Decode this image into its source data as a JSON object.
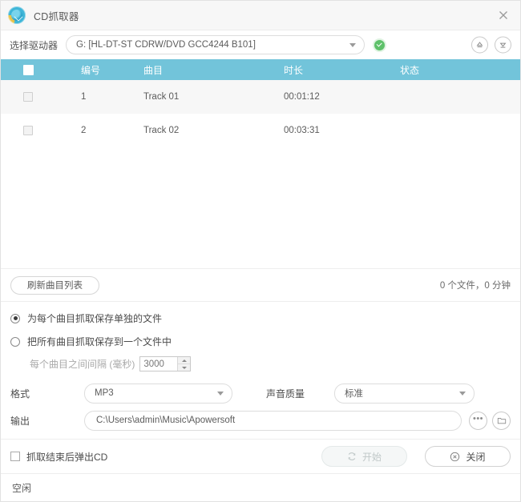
{
  "window": {
    "title": "CD抓取器",
    "logo_icon": "cd-ripper-logo-icon",
    "close_icon": "close-icon"
  },
  "drive": {
    "label": "选择驱动器",
    "selected": "G: [HL-DT-ST CDRW/DVD GCC4244 B101]",
    "status_icon": "green-check-icon",
    "eject_icon": "eject-icon",
    "close_tray_icon": "close-tray-icon"
  },
  "table": {
    "columns": [
      "",
      "编号",
      "曲目",
      "时长",
      "状态"
    ],
    "header_checkbox_icon": "select-all-checkbox",
    "rows": [
      {
        "checked": false,
        "no": "1",
        "title": "Track 01",
        "duration": "00:01:12",
        "status": ""
      },
      {
        "checked": false,
        "no": "2",
        "title": "Track 02",
        "duration": "00:03:31",
        "status": ""
      }
    ]
  },
  "toolbar": {
    "refresh_label": "刷新曲目列表",
    "counts": "0 个文件，0 分钟"
  },
  "save_mode": {
    "separate_label": "为每个曲目抓取保存单独的文件",
    "merged_label": "把所有曲目抓取保存到一个文件中",
    "selected": "separate",
    "gap_label": "每个曲目之间间隔 (毫秒)",
    "gap_value": "3000"
  },
  "settings": {
    "format_label": "格式",
    "format_value": "MP3",
    "quality_label": "声音质量",
    "quality_value": "标准",
    "output_label": "输出",
    "output_path": "C:\\Users\\admin\\Music\\Apowersoft",
    "browse_icon": "ellipsis-icon",
    "open_folder_icon": "folder-open-icon"
  },
  "actions": {
    "eject_after_label": "抓取结束后弹出CD",
    "eject_after_checked": false,
    "start_label": "开始",
    "start_icon": "refresh-arrows-icon",
    "start_disabled": true,
    "close_label": "关闭",
    "close_icon": "circle-x-icon"
  },
  "status": {
    "text": "空闲"
  },
  "colors": {
    "header_teal": "#72c4da",
    "ok_green": "#5ec16a",
    "row_alt": "#f7f7f7"
  }
}
